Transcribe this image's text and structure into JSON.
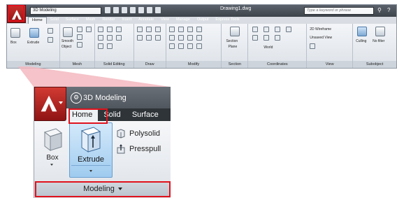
{
  "thumbnail": {
    "workspace": "3D Modeling",
    "document_title": "Drawing1.dwg",
    "search_placeholder": "Type a keyword or phrase",
    "tabs": [
      "Home",
      "Solid",
      "Surface",
      "Mesh",
      "Render",
      "Insert",
      "Annotate",
      "View",
      "Manage",
      "Output",
      "Express Tools"
    ],
    "active_tab": "Home",
    "panel_titles": [
      "Modeling",
      "Mesh",
      "Solid Editing",
      "Draw",
      "Modify",
      "Section",
      "Coordinates",
      "View",
      "Subobject"
    ],
    "modeling_labels": [
      "Box",
      "Extrude"
    ],
    "mesh_labels": [
      "Smooth",
      "Object"
    ],
    "section_labels": [
      "Section",
      "Plane"
    ],
    "view_style": "2D Wireframe",
    "view_name": "Unsaved View",
    "coordinates_world": "World",
    "culling_label": "Culling",
    "no_filter_label": "No filter"
  },
  "zoomed": {
    "workspace": "3D Modeling",
    "tabs": [
      "Home",
      "Solid",
      "Surface"
    ],
    "active_tab": "Home",
    "box_label": "Box",
    "extrude_label": "Extrude",
    "polysolid_label": "Polysolid",
    "presspull_label": "Presspull",
    "panel_title": "Modeling"
  },
  "highlight_color": "#e0121c",
  "app_button_color": "#b42020"
}
